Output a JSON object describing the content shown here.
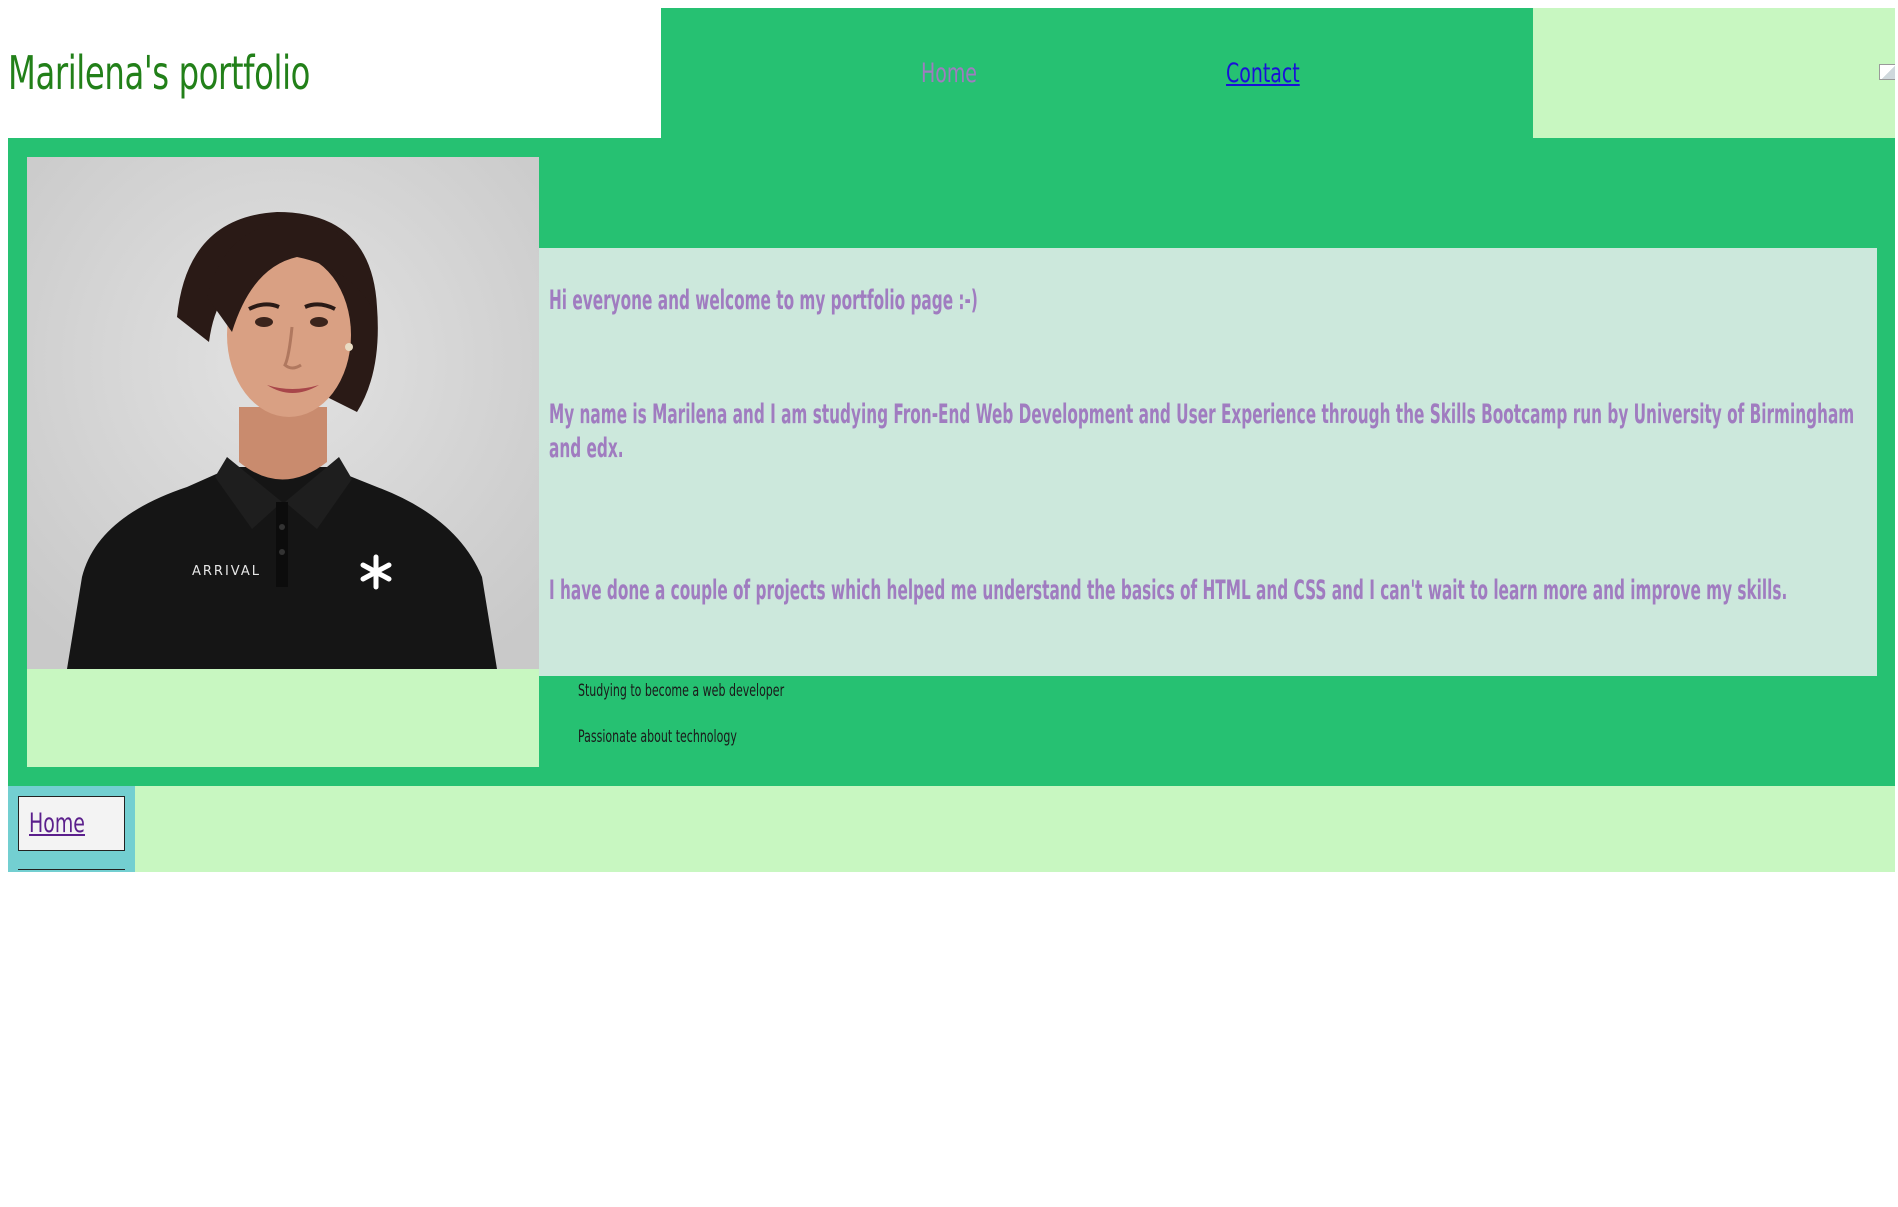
{
  "header": {
    "site_title": "Marilena's portfolio",
    "nav": {
      "home": "Home",
      "contact": "Contact"
    }
  },
  "main": {
    "intro": {
      "welcome": "Hi everyone and welcome to my portfolio page :-)",
      "name": "My name is Marilena and I am studying Fron-End Web Development and User Experience through the Skills Bootcamp run by University of Birmingham and edx.",
      "projects": "I have done a couple of projects which helped me understand the basics of HTML and CSS and I can't wait to learn more and improve my skills."
    },
    "traits": [
      "Studying to become a web developer",
      "Passionate about technology"
    ]
  },
  "footer": {
    "nav": {
      "home": "Home"
    }
  },
  "colors": {
    "title_green": "#228019",
    "primary_green": "#26c172",
    "light_green": "#c8f7c1",
    "intro_bg": "#cce8dc",
    "intro_text": "#a07cc0",
    "contact_link": "#1a10d8",
    "footer_nav_bg": "#73cfd1"
  },
  "icons": {
    "broken_image": "broken-image-icon"
  }
}
